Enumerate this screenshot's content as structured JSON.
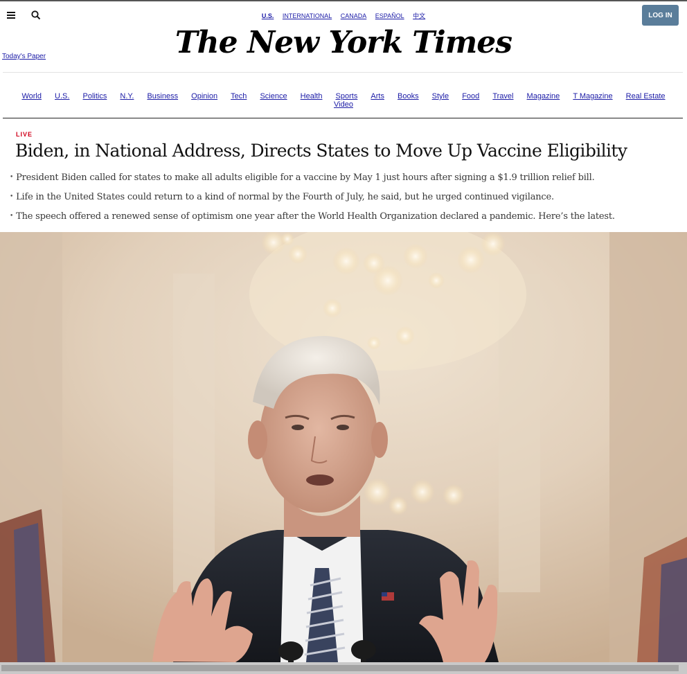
{
  "header": {
    "edition_links": [
      {
        "label": "U.S.",
        "active": true
      },
      {
        "label": "INTERNATIONAL",
        "active": false
      },
      {
        "label": "CANADA",
        "active": false
      },
      {
        "label": "ESPAÑOL",
        "active": false
      },
      {
        "label": "中文",
        "active": false
      }
    ],
    "login_label": "LOG IN",
    "todays_paper": "Today's Paper",
    "masthead": "The New York Times",
    "icons": {
      "menu": "hamburger-menu-icon",
      "search": "search-icon"
    },
    "login_color": "#5a7d9a"
  },
  "section_nav": [
    "World",
    "U.S.",
    "Politics",
    "N.Y.",
    "Business",
    "Opinion",
    "Tech",
    "Science",
    "Health",
    "Sports",
    "Arts",
    "Books",
    "Style",
    "Food",
    "Travel",
    "Magazine",
    "T Magazine",
    "Real Estate",
    "Video"
  ],
  "story": {
    "tag": "LIVE",
    "tag_color": "#d0021b",
    "headline": "Biden, in National Address, Directs States to Move Up Vaccine Eligibility",
    "bullets": [
      "President Biden called for states to make all adults eligible for a vaccine by May 1 just hours after signing a $1.9 trillion relief bill.",
      "Life in the United States could return to a kind of normal by the Fourth of July, he said, but he urged continued vigilance.",
      "The speech offered a renewed sense of optimism one year after the World Health Organization declared a pandemic. Here’s the latest."
    ]
  }
}
